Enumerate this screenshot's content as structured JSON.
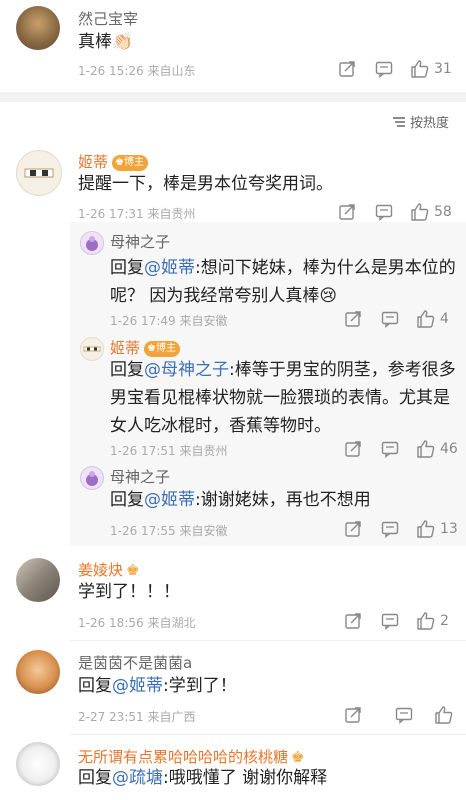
{
  "comments": [
    {
      "name": "然己宝宰",
      "text": "真棒👏🏻",
      "meta": "1-26 15:26  来自山东",
      "likes": "31"
    },
    {
      "name": "姬蒂",
      "badge": "博主",
      "text": "提醒一下，棒是男本位夸奖用词。",
      "meta": "1-26 17:31  来自贵州",
      "likes": "58",
      "replies": [
        {
          "name": "母神之子",
          "prefix": "回复",
          "mention": "@姬蒂",
          "text_line1": ":想问下姥妹，棒为什么是男本位的",
          "text_line2": "呢？ 因为我经常夸别人真棒😢",
          "meta": "1-26 17:49  来自安徽",
          "likes": "4"
        },
        {
          "name": "姬蒂",
          "badge": "博主",
          "prefix": "回复",
          "mention": "@母神之子",
          "text_line1": ":棒等于男宝的阴茎，参考很多",
          "text_line2": "男宝看见棍棒状物就一脸猥琐的表情。尤其是",
          "text_line3": "女人吃冰棍时，香蕉等物时。",
          "meta": "1-26 17:51  来自贵州",
          "likes": "46"
        },
        {
          "name": "母神之子",
          "prefix": "回复",
          "mention": "@姬蒂",
          "text_line1": ":谢谢姥妹，再也不想用",
          "meta": "1-26 17:55  来自安徽",
          "likes": "13"
        }
      ]
    },
    {
      "name": "姜婈炔",
      "text": "学到了！！！",
      "meta": "1-26 18:56  来自湖北",
      "likes": "2"
    },
    {
      "name": "是茵茵不是菌菌a",
      "prefix": "回复",
      "mention": "@姬蒂",
      "text": ":学到了！",
      "meta": "2-27 23:51  来自广西",
      "likes": ""
    },
    {
      "name": "无所谓有点累哈哈哈哈的核桃糖",
      "prefix": "回复",
      "mention": "@疏塘",
      "text": ":哦哦懂了 谢谢你解释"
    }
  ],
  "sort": {
    "label": "按热度"
  }
}
